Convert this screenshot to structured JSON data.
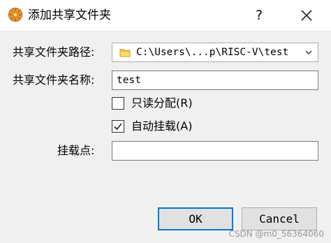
{
  "dialog": {
    "title": "添加共享文件夹",
    "help_label": "?",
    "icon": "virtualbox-app-icon"
  },
  "form": {
    "folder_path_label": "共享文件夹路径:",
    "folder_path_value": "C:\\Users\\...p\\RISC-V\\test",
    "folder_name_label": "共享文件夹名称:",
    "folder_name_value": "test",
    "read_only_label": "只读分配(R)",
    "read_only_checked": false,
    "auto_mount_label": "自动挂载(A)",
    "auto_mount_checked": true,
    "mount_point_label": "挂载点:",
    "mount_point_value": ""
  },
  "buttons": {
    "ok_label": "OK",
    "cancel_label": "Cancel"
  },
  "watermark": "CSDN @m0_56364060",
  "colors": {
    "focus_border": "#0078d7",
    "dialog_bg": "#f0f0f0"
  }
}
